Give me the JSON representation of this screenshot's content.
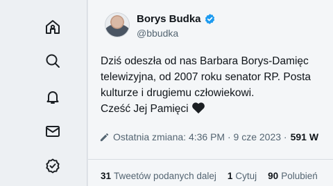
{
  "sidebar": {
    "items": [
      {
        "icon": "home-icon"
      },
      {
        "icon": "search-icon"
      },
      {
        "icon": "notifications-icon"
      },
      {
        "icon": "messages-icon"
      },
      {
        "icon": "verified-icon"
      }
    ]
  },
  "tweet": {
    "author_name": "Borys Budka",
    "author_handle": "@bbudka",
    "lines": [
      "Dziś odeszła od nas Barbara Borys-Damięc",
      "telewizyjna, od 2007 roku senator RP. Posta",
      "kulturze i drugiemu człowiekowi.",
      "Cześć Jej Pamięci"
    ],
    "edited_label": "Ostatnia zmiana: 4:36 PM · 9 cze 2023 ·",
    "views_count": "591 W",
    "stats": {
      "retweets_count": "31",
      "retweets_label": "Tweetów podanych dalej",
      "quotes_count": "1",
      "quotes_label": "Cytuj",
      "likes_count": "90",
      "likes_label": "Polubień"
    }
  },
  "colors": {
    "verified_blue": "#1d9bf0",
    "text_secondary": "#536471",
    "text_primary": "#0f1419"
  }
}
